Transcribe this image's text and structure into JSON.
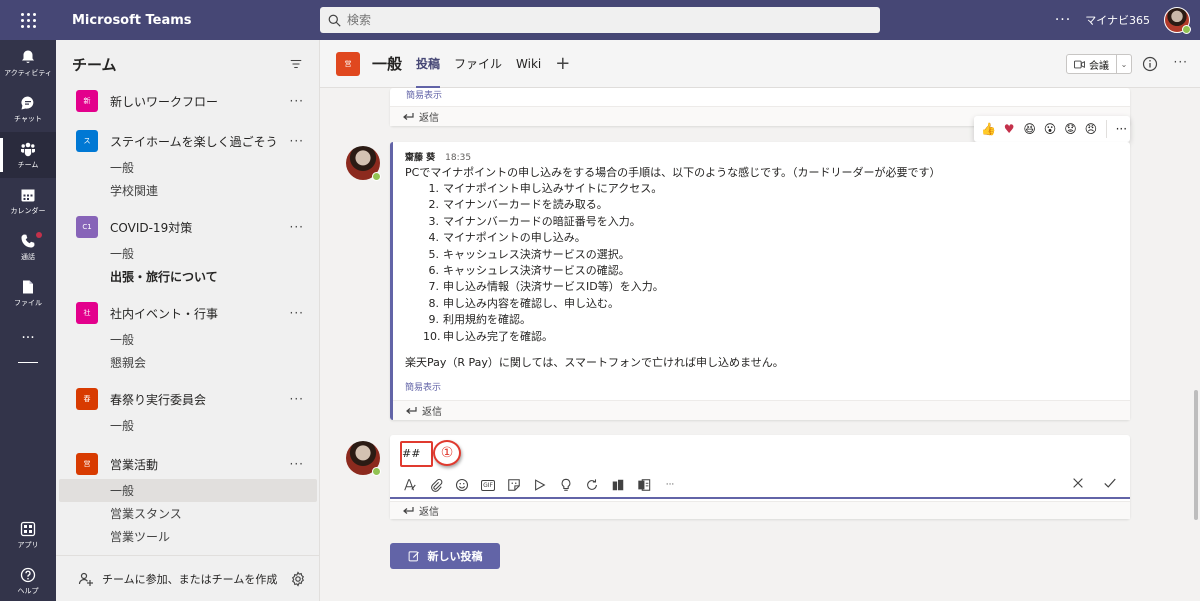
{
  "app": {
    "title": "Microsoft Teams",
    "org": "マイナビ365"
  },
  "search": {
    "placeholder": "検索"
  },
  "rail": {
    "items": [
      {
        "label": "アクティビティ",
        "icon": "bell-icon"
      },
      {
        "label": "チャット",
        "icon": "chat-icon"
      },
      {
        "label": "チーム",
        "icon": "teams-icon"
      },
      {
        "label": "カレンダー",
        "icon": "calendar-icon"
      },
      {
        "label": "通話",
        "icon": "phone-icon"
      },
      {
        "label": "ファイル",
        "icon": "file-icon"
      }
    ],
    "more": "···",
    "apps_label": "アプリ",
    "help_label": "ヘルプ"
  },
  "teams_pane": {
    "title": "チーム",
    "teams": [
      {
        "name": "新しいワークフロー",
        "tile": "新",
        "color": "#e3008c",
        "channels": []
      },
      {
        "name": "ステイホームを楽しく過ごそう",
        "tile": "ス",
        "color": "#0078d4",
        "channels": [
          {
            "name": "一般"
          },
          {
            "name": "学校関連"
          }
        ]
      },
      {
        "name": "COVID-19対策",
        "tile": "C1",
        "color": "#8764b8",
        "channels": [
          {
            "name": "一般"
          },
          {
            "name": "出張・旅行について"
          }
        ]
      },
      {
        "name": "社内イベント・行事",
        "tile": "社",
        "color": "#e3008c",
        "channels": [
          {
            "name": "一般"
          },
          {
            "name": "懇親会"
          }
        ]
      },
      {
        "name": "春祭り実行委員会",
        "tile": "春",
        "color": "#d83b01",
        "channels": [
          {
            "name": "一般"
          }
        ]
      },
      {
        "name": "営業活動",
        "tile": "営",
        "color": "#d83b01",
        "channels": [
          {
            "name": "一般"
          },
          {
            "name": "営業スタンス"
          },
          {
            "name": "営業ツール"
          }
        ]
      }
    ],
    "footer": "チームに参加、またはチームを作成"
  },
  "channel": {
    "tile": "営",
    "title": "一般",
    "tabs": [
      "投稿",
      "ファイル",
      "Wiki"
    ],
    "meet_label": "会議"
  },
  "posts": {
    "collapse_link": "簡易表示",
    "reply_label": "返信",
    "main": {
      "author": "齋藤 葵",
      "time": "18:35",
      "intro": "PCでマイナポイントの申し込みをする場合の手順は、以下のような感じです。（カードリーダーが必要です）",
      "steps": [
        "マイナポイント申し込みサイトにアクセス。",
        "マイナンバーカードを読み取る。",
        "マイナンバーカードの暗証番号を入力。",
        "マイナポイントの申し込み。",
        "キャッシュレス決済サービスの選択。",
        "キャッシュレス決済サービスの確認。",
        "申し込み情報（決済サービスID等）を入力。",
        "申し込み内容を確認し、申し込む。",
        "利用規約を確認。",
        "申し込み完了を確認。"
      ],
      "outro": "楽天Pay（R Pay）に関しては、スマートフォンで亡ければ申し込めません。"
    },
    "reactions": [
      "👍",
      "♥",
      "😆",
      "😮",
      "😟",
      "😠"
    ]
  },
  "compose": {
    "value": "##",
    "callout": "①"
  },
  "new_post_label": "新しい投稿"
}
